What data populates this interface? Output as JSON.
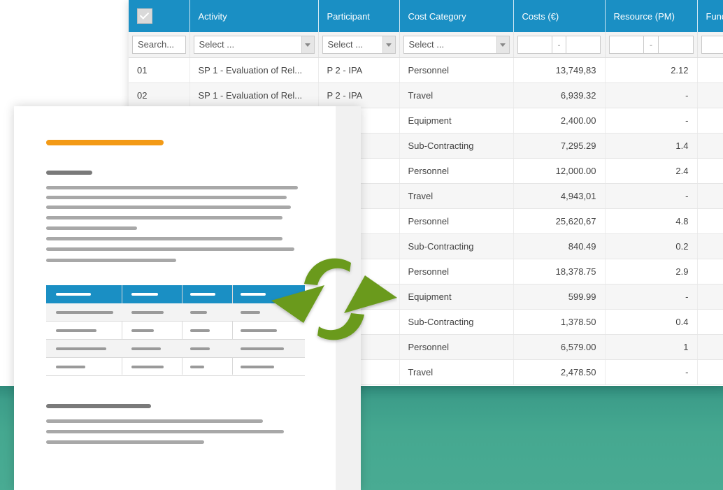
{
  "colors": {
    "header_blue": "#1a8fc4",
    "accent_orange": "#f39a16",
    "sync_green": "#6a9a1f",
    "band_teal": "#45a890"
  },
  "icons": [
    "checkbox-icon",
    "dropdown-arrow-icon",
    "sync-icon"
  ],
  "table": {
    "columns": [
      "",
      "Activity",
      "Participant",
      "Cost Category",
      "Costs (€)",
      "Resource (PM)",
      "Fundi"
    ],
    "filters": {
      "search_placeholder": "Search...",
      "activity_select": "Select ...",
      "participant_select": "Select ...",
      "category_select": "Select ...",
      "range_dash": "-"
    },
    "rows": [
      {
        "idx": "01",
        "activity": "SP 1 - Evaluation of Rel...",
        "participant": "P 2 - IPA",
        "category": "Personnel",
        "costs": "13,749,83",
        "resource": "2.12"
      },
      {
        "idx": "02",
        "activity": "SP 1 - Evaluation of Rel...",
        "participant": "P 2 - IPA",
        "category": "Travel",
        "costs": "6,939.32",
        "resource": "-"
      },
      {
        "idx": "",
        "activity": "",
        "participant": "",
        "category": "Equipment",
        "costs": "2,400.00",
        "resource": "-"
      },
      {
        "idx": "",
        "activity": "",
        "participant": "",
        "category": "Sub-Contracting",
        "costs": "7,295.29",
        "resource": "1.4"
      },
      {
        "idx": "",
        "activity": "",
        "participant": "",
        "category": "Personnel",
        "costs": "12,000.00",
        "resource": "2.4"
      },
      {
        "idx": "",
        "activity": "",
        "participant": "",
        "category": "Travel",
        "costs": "4,943,01",
        "resource": "-"
      },
      {
        "idx": "",
        "activity": "",
        "participant": "",
        "category": "Personnel",
        "costs": "25,620,67",
        "resource": "4.8"
      },
      {
        "idx": "",
        "activity": "",
        "participant": "",
        "category": "Sub-Contracting",
        "costs": "840.49",
        "resource": "0.2"
      },
      {
        "idx": "",
        "activity": "",
        "participant": "",
        "category": "Personnel",
        "costs": "18,378.75",
        "resource": "2.9"
      },
      {
        "idx": "",
        "activity": "",
        "participant": "",
        "category": "Equipment",
        "costs": "599.99",
        "resource": "-"
      },
      {
        "idx": "",
        "activity": "",
        "participant": "",
        "category": "Sub-Contracting",
        "costs": "1,378.50",
        "resource": "0.4"
      },
      {
        "idx": "",
        "activity": "",
        "participant": "",
        "category": "Personnel",
        "costs": "6,579.00",
        "resource": "1"
      },
      {
        "idx": "",
        "activity": "",
        "participant": "",
        "category": "Travel",
        "costs": "2,478.50",
        "resource": "-"
      }
    ]
  }
}
